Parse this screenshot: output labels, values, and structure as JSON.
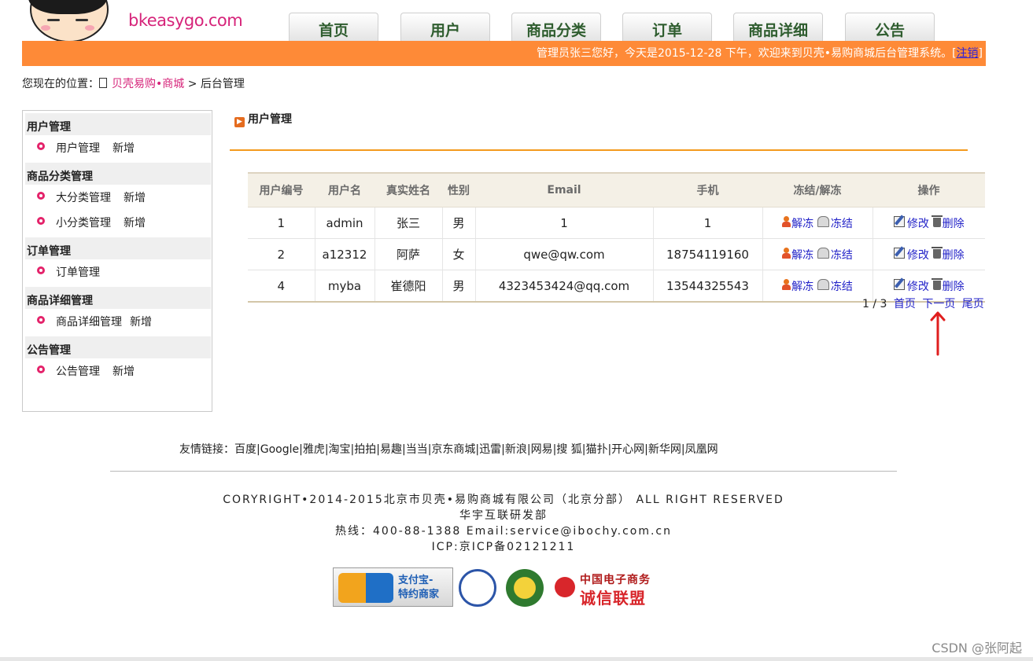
{
  "header": {
    "logo_text": "bkeasygo.com",
    "nav_tabs": [
      "首页",
      "用户",
      "商品分类",
      "订单",
      "商品详细",
      "公告"
    ],
    "welcome_text": "管理员张三您好，今天是2015-12-28 下午，欢迎来到贝壳•易购商城后台管理系统。[",
    "logout_label": "注销",
    "welcome_suffix": "]"
  },
  "breadcrumb": {
    "prefix": "您现在的位置：",
    "home": "贝壳易购•商城",
    "separator": " > ",
    "current": "后台管理"
  },
  "sidebar": {
    "sections": [
      {
        "title": "用户管理",
        "items": [
          {
            "label": "用户管理",
            "add": "新增"
          }
        ]
      },
      {
        "title": "商品分类管理",
        "items": [
          {
            "label": "大分类管理",
            "add": "新增"
          },
          {
            "label": "小分类管理",
            "add": "新增"
          }
        ]
      },
      {
        "title": "订单管理",
        "items": [
          {
            "label": "订单管理",
            "add": ""
          }
        ]
      },
      {
        "title": "商品详细管理",
        "items": [
          {
            "label": "商品详细管理",
            "add": "新增"
          }
        ]
      },
      {
        "title": "公告管理",
        "items": [
          {
            "label": "公告管理",
            "add": "新增"
          }
        ]
      }
    ]
  },
  "content": {
    "title": "用户管理",
    "table": {
      "columns": [
        "用户编号",
        "用户名",
        "真实姓名",
        "性别",
        "Email",
        "手机",
        "冻结/解冻",
        "操作"
      ],
      "rows": [
        [
          "1",
          "admin",
          "张三",
          "男",
          "1",
          "1"
        ],
        [
          "2",
          "a12312",
          "阿萨",
          "女",
          "qwe@qw.com",
          "18754119160"
        ],
        [
          "4",
          "myba",
          "崔德阳",
          "男",
          "4323453424@qq.com",
          "13544325543"
        ]
      ],
      "actions": {
        "unfreeze": "解冻",
        "freeze": "冻结",
        "edit": "修改",
        "delete": "删除"
      }
    },
    "pager": {
      "status": "1 / 3",
      "first": "首页",
      "next": "下一页",
      "last": "尾页"
    }
  },
  "footer": {
    "links_label": "友情链接：",
    "links": [
      "百度",
      "Google",
      "雅虎",
      "淘宝",
      "拍拍",
      "易趣",
      "当当",
      "京东商城",
      "迅雷",
      "新浪",
      "网易",
      "搜 狐",
      "猫扑",
      "开心网",
      "新华网",
      "凤凰网"
    ],
    "copyright": "CORYRIGHT•2014-2015北京市贝壳•易购商城有限公司（北京分部） ALL RIGHT RESERVED",
    "dept": "华宇互联研发部",
    "hotline": "热线：400-88-1388 Email:service@ibochy.com.cn",
    "icp": "ICP:京ICP备02121211",
    "badges": {
      "alipay_line1": "支付宝-",
      "alipay_line2": "特约商家",
      "cert_line1": "中国电子商务",
      "cert_line2": "诚信联盟"
    }
  },
  "watermark": "CSDN @张阿起",
  "colors": {
    "orange_bar": "#fe8a37",
    "link_blue": "#2323c8",
    "brand_pink": "#d6247a"
  }
}
